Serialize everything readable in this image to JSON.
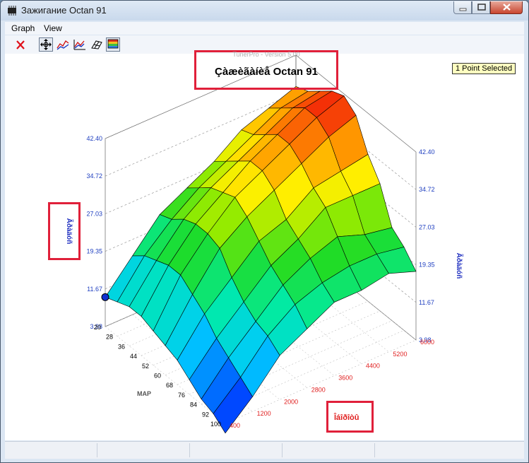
{
  "window": {
    "title": "Зажигание Octan 91"
  },
  "menu": [
    {
      "label": "Graph"
    },
    {
      "label": "View"
    }
  ],
  "toolbar": {
    "buttons": [
      {
        "name": "close-graph-button",
        "icon": "red-x-icon"
      },
      {
        "name": "rotate-move-button",
        "icon": "move-cross-icon",
        "pressed": true
      },
      {
        "name": "edit-point-button",
        "icon": "curve-edit-icon"
      },
      {
        "name": "line-edit-button",
        "icon": "line-graph-icon"
      },
      {
        "name": "surface-button",
        "icon": "surface-icon"
      },
      {
        "name": "color-surface-button",
        "icon": "color-grid-icon",
        "pressed": true
      }
    ]
  },
  "status": {
    "selected": "1 Point Selected"
  },
  "chart_data": {
    "type": "surface",
    "version": "TunerPro - Version 5.00",
    "title": "Çàæèãàíèå Octan 91",
    "zlabel_left": "Ãðàäóñ",
    "zlabel_right": "Ãðàäóñ",
    "xlabel": "MAP",
    "ylabel": "Îáîðîòû",
    "z_ticks": [
      "3.98",
      "11.67",
      "19.35",
      "27.03",
      "34.72",
      "42.40"
    ],
    "map_ticks": [
      "20",
      "28",
      "36",
      "44",
      "52",
      "60",
      "68",
      "76",
      "84",
      "92",
      "100"
    ],
    "rpm_ticks": [
      "400",
      "1200",
      "2000",
      "2800",
      "3600",
      "4400",
      "5200",
      "6000"
    ],
    "zlim": [
      3.98,
      42.4
    ],
    "map_values": [
      20,
      28,
      36,
      44,
      52,
      60,
      68,
      76,
      84,
      92,
      100
    ],
    "rpm_values": [
      400,
      1200,
      2000,
      2800,
      3600,
      4400,
      5200,
      6000
    ],
    "z_values": [
      [
        10,
        16,
        22,
        25,
        28,
        32,
        34,
        36
      ],
      [
        11,
        18,
        23,
        27,
        30,
        33,
        36,
        37
      ],
      [
        12,
        19,
        25,
        29,
        32,
        35,
        38,
        39
      ],
      [
        12,
        20,
        26,
        30,
        34,
        37,
        40,
        41
      ],
      [
        11,
        20,
        26,
        31,
        34,
        37,
        40,
        42
      ],
      [
        10,
        18,
        25,
        29,
        32,
        35,
        38,
        40
      ],
      [
        9,
        16,
        21,
        26,
        28,
        32,
        33,
        34
      ],
      [
        7,
        13,
        18,
        23,
        26,
        30,
        30,
        30
      ],
      [
        5,
        11,
        16,
        21,
        24,
        26,
        24,
        23
      ],
      [
        4,
        9,
        15,
        19,
        21,
        22,
        22,
        21
      ],
      [
        2,
        7,
        13,
        16,
        19,
        19,
        20,
        18
      ]
    ],
    "selected_point": {
      "map": 20,
      "rpm": 400
    },
    "grid": true
  }
}
